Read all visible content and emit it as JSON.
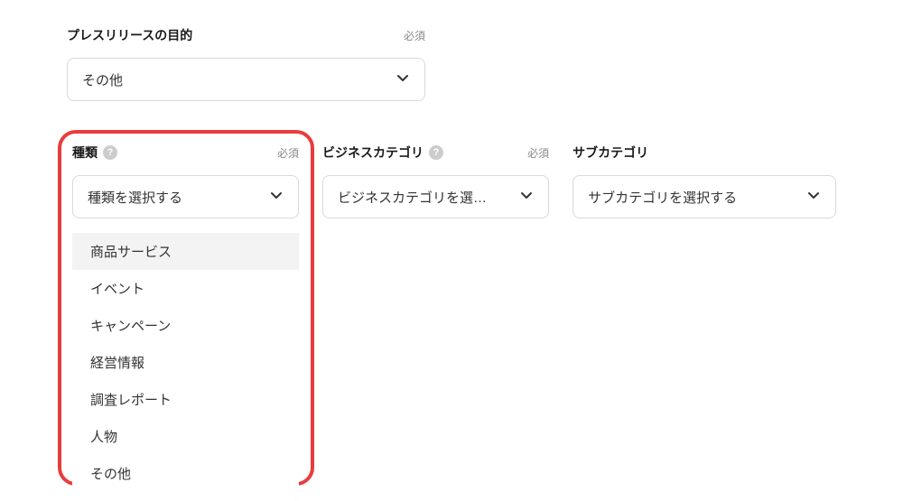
{
  "purpose": {
    "label": "プレスリリースの目的",
    "required": "必須",
    "value": "その他"
  },
  "type": {
    "label": "種類",
    "required": "必須",
    "placeholder": "種類を選択する",
    "options": [
      "商品サービス",
      "イベント",
      "キャンペーン",
      "経営情報",
      "調査レポート",
      "人物",
      "その他"
    ]
  },
  "bizcat": {
    "label": "ビジネスカテゴリ",
    "required": "必須",
    "placeholder": "ビジネスカテゴリを選…"
  },
  "subcat": {
    "label": "サブカテゴリ",
    "placeholder": "サブカテゴリを選択する"
  }
}
